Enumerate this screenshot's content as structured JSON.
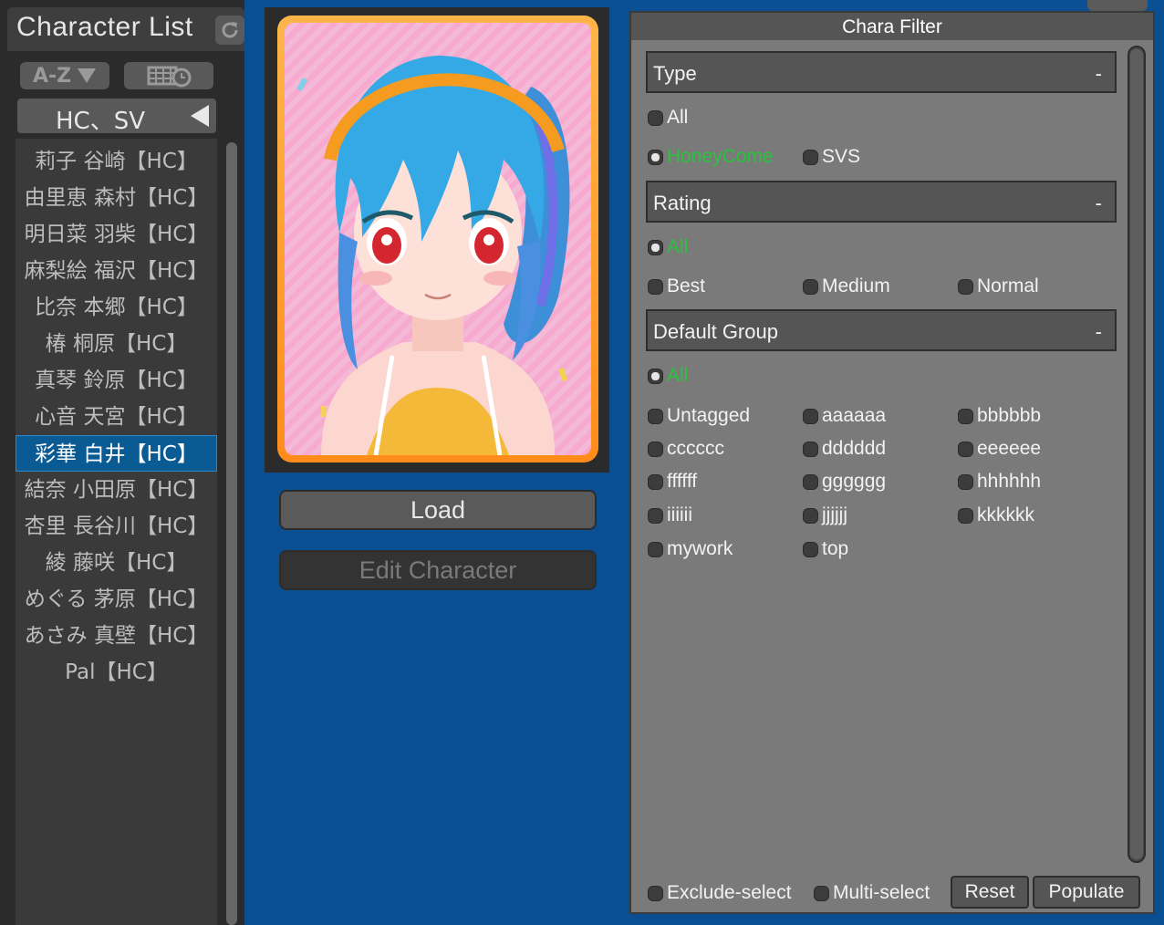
{
  "left_panel": {
    "title": "Character List",
    "sort_label": "A-Z",
    "group_label": "HC、SV",
    "characters": [
      "莉子 谷崎【HC】",
      "由里恵 森村【HC】",
      "明日菜 羽柴【HC】",
      "麻梨絵 福沢【HC】",
      "比奈 本郷【HC】",
      "椿 桐原【HC】",
      "真琴 鈴原【HC】",
      "心音 天宮【HC】",
      "彩華 白井【HC】",
      "結奈 小田原【HC】",
      "杏里 長谷川【HC】",
      "綾 藤咲【HC】",
      "めぐる 茅原【HC】",
      "あさみ 真壁【HC】",
      "Pal【HC】"
    ],
    "selected_index": 8
  },
  "actions": {
    "load_label": "Load",
    "edit_label": "Edit Character"
  },
  "filter": {
    "title": "Chara Filter",
    "type_header": "Type",
    "rating_header": "Rating",
    "group_header": "Default Group",
    "collapse_symbol": "-",
    "type_options": {
      "all": "All",
      "honeycome": "HoneyCome",
      "svs": "SVS"
    },
    "rating_options": {
      "all": "All",
      "best": "Best",
      "medium": "Medium",
      "normal": "Normal"
    },
    "group_options": {
      "all": "All",
      "items": [
        "Untagged",
        "aaaaaa",
        "bbbbbb",
        "cccccc",
        "dddddd",
        "eeeeee",
        "ffffff",
        "gggggg",
        "hhhhhh",
        "iiiiii",
        "jjjjjj",
        "kkkkkk",
        "mywork",
        "top"
      ]
    },
    "footer": {
      "exclude_select": "Exclude-select",
      "multi_select": "Multi-select",
      "reset": "Reset",
      "populate": "Populate"
    }
  },
  "colors": {
    "background": "#0b4f93",
    "selected_item": "#0a5a94",
    "active_option": "#27c43a",
    "card_border": "#ff9d2e"
  }
}
